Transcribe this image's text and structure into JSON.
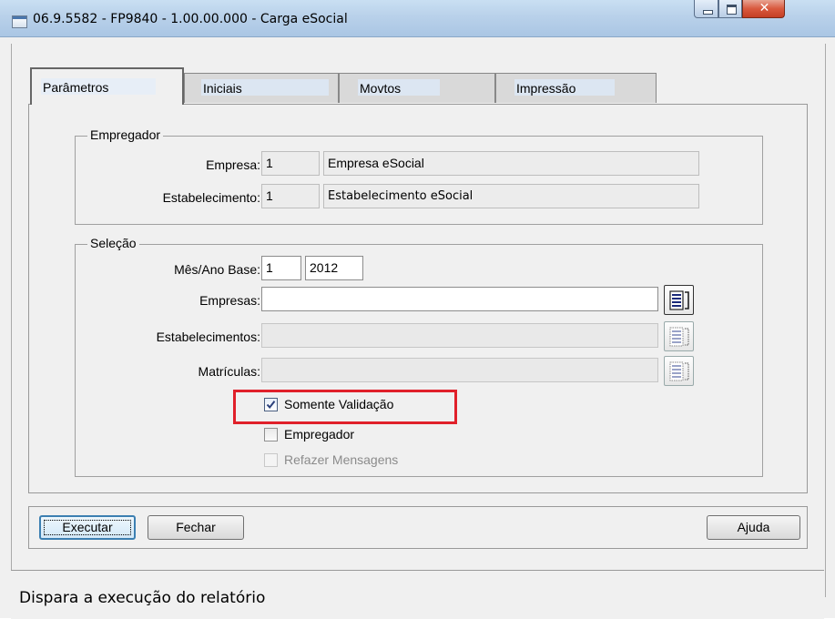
{
  "window": {
    "title": "06.9.5582 - FP9840 - 1.00.00.000 - Carga eSocial"
  },
  "tabs": [
    {
      "label": "Parâmetros",
      "active": true
    },
    {
      "label": "Iniciais",
      "active": false
    },
    {
      "label": "Movtos",
      "active": false
    },
    {
      "label": "Impressão",
      "active": false
    }
  ],
  "empregador_group": {
    "legend": "Empregador",
    "empresa_label": "Empresa:",
    "empresa_code": "1",
    "empresa_name": "Empresa eSocial",
    "estab_label": "Estabelecimento:",
    "estab_code": "1",
    "estab_name": "Estabelecimento eSocial"
  },
  "selecao_group": {
    "legend": "Seleção",
    "mes_ano_label": "Mês/Ano Base:",
    "mes_value": "1",
    "ano_value": "2012",
    "empresas_label": "Empresas:",
    "empresas_value": "",
    "estabelecimentos_label": "Estabelecimentos:",
    "estabelecimentos_value": "",
    "matriculas_label": "Matrículas:",
    "matriculas_value": "",
    "checkboxes": [
      {
        "label": "Somente Validação",
        "checked": true,
        "enabled": true
      },
      {
        "label": "Empregador",
        "checked": false,
        "enabled": true
      },
      {
        "label": "Refazer Mensagens",
        "checked": false,
        "enabled": false
      }
    ]
  },
  "buttons": {
    "executar": "Executar",
    "fechar": "Fechar",
    "ajuda": "Ajuda"
  },
  "status": {
    "text": "Dispara a execução do relatório"
  },
  "colors": {
    "highlight_box": "#e0202a",
    "titlebar": "#b9d1ea",
    "close_button": "#d9593e"
  },
  "icons": [
    "window-icon",
    "minimize-icon",
    "maximize-icon",
    "close-icon",
    "zoom-list-icon",
    "checkbox-check-icon"
  ]
}
